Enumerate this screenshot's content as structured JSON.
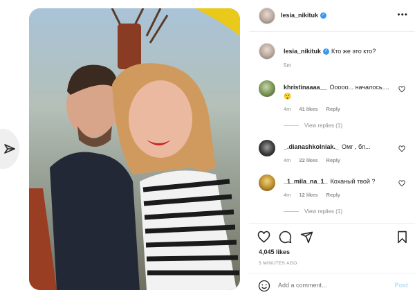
{
  "post": {
    "username": "lesia_nikituk",
    "caption": "Кто же это кто?",
    "caption_time": "5m",
    "likes": "4,045 likes",
    "time_ago": "5 MINUTES AGO"
  },
  "comments": [
    {
      "username": "khristinaaaa__",
      "text": "Ооооо... началось....😲",
      "time": "4m",
      "likes": "41 likes",
      "reply": "Reply",
      "view_replies": "View replies (1)"
    },
    {
      "username": "_.dianashkolniak._",
      "text": "Омг , бл...",
      "time": "4m",
      "likes": "22 likes",
      "reply": "Reply"
    },
    {
      "username": "_1_mila_na_1_",
      "text": "Коханый твой ?",
      "time": "4m",
      "likes": "12 likes",
      "reply": "Reply",
      "view_replies": "View replies (1)"
    }
  ],
  "add_comment": {
    "placeholder": "Add a comment...",
    "post_label": "Post"
  },
  "icons": {
    "more": "more-options-icon",
    "heart": "heart-icon",
    "comment": "comment-icon",
    "share": "share-icon",
    "bookmark": "bookmark-icon",
    "emoji": "emoji-icon",
    "verified": "verified-badge-icon",
    "nav": "next-arrow-icon"
  },
  "colors": {
    "accent": "#3897f0",
    "muted": "#8e8e8e",
    "post_disabled": "#b2dffc"
  }
}
